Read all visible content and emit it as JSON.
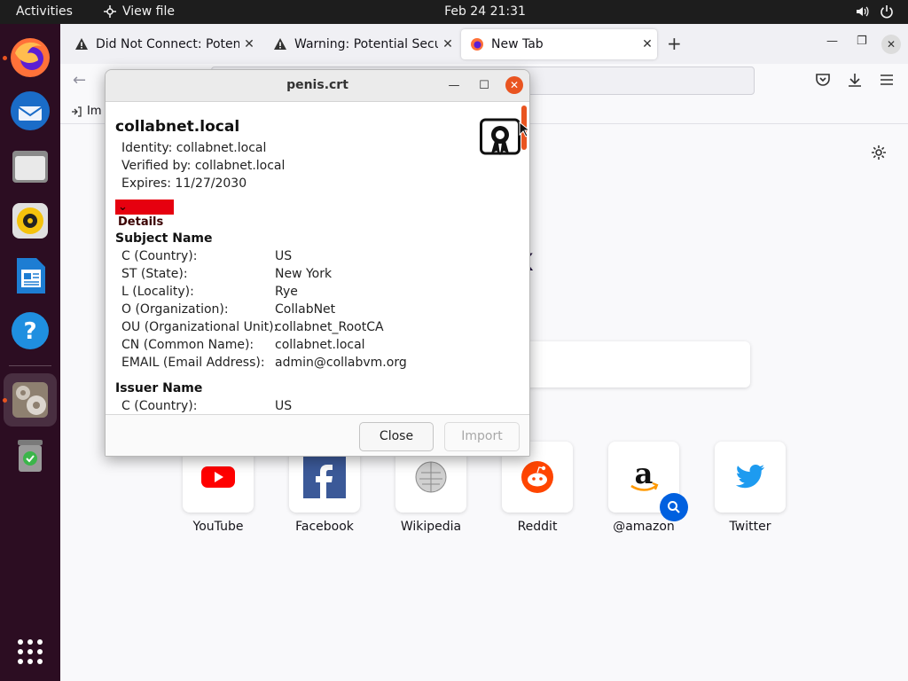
{
  "topbar": {
    "activities": "Activities",
    "app_name": "View file",
    "clock": "Feb 24  21:31"
  },
  "dock": {
    "items": [
      "Firefox",
      "Thunderbird",
      "Files",
      "Rhythmbox",
      "LibreOffice Writer",
      "Help",
      "Certificate Viewer",
      "Trash",
      "Show Applications"
    ]
  },
  "browser": {
    "tabs": [
      {
        "title": "Did Not Connect: Potenti",
        "icon": "warning-icon"
      },
      {
        "title": "Warning: Potential Securi",
        "icon": "warning-icon"
      },
      {
        "title": "New Tab",
        "icon": "firefox-icon"
      }
    ],
    "bookmark": "Im",
    "wordmark": "fox",
    "shortcuts": [
      {
        "label": "YouTube"
      },
      {
        "label": "Facebook"
      },
      {
        "label": "Wikipedia"
      },
      {
        "label": "Reddit"
      },
      {
        "label": "@amazon"
      },
      {
        "label": "Twitter"
      }
    ]
  },
  "dialog": {
    "title": "penis.crt",
    "common_name": "collabnet.local",
    "identity": "Identity: collabnet.local",
    "verified_by": "Verified by: collabnet.local",
    "expires": "Expires: 11/27/2030",
    "details_label": "Details",
    "subject": {
      "title": "Subject Name",
      "rows": [
        {
          "key": "C (Country):",
          "value": "US"
        },
        {
          "key": "ST (State):",
          "value": "New York"
        },
        {
          "key": "L (Locality):",
          "value": "Rye"
        },
        {
          "key": "O (Organization):",
          "value": "CollabNet"
        },
        {
          "key": "OU (Organizational Unit):",
          "value": "collabnet_RootCA"
        },
        {
          "key": "CN (Common Name):",
          "value": "collabnet.local"
        },
        {
          "key": "EMAIL (Email Address):",
          "value": "admin@collabvm.org"
        }
      ]
    },
    "issuer": {
      "title": "Issuer Name",
      "rows": [
        {
          "key": "C (Country):",
          "value": "US"
        }
      ]
    },
    "buttons": {
      "close": "Close",
      "import": "Import"
    }
  },
  "colors": {
    "accent": "#e95420",
    "details_highlight": "#e6000f"
  }
}
